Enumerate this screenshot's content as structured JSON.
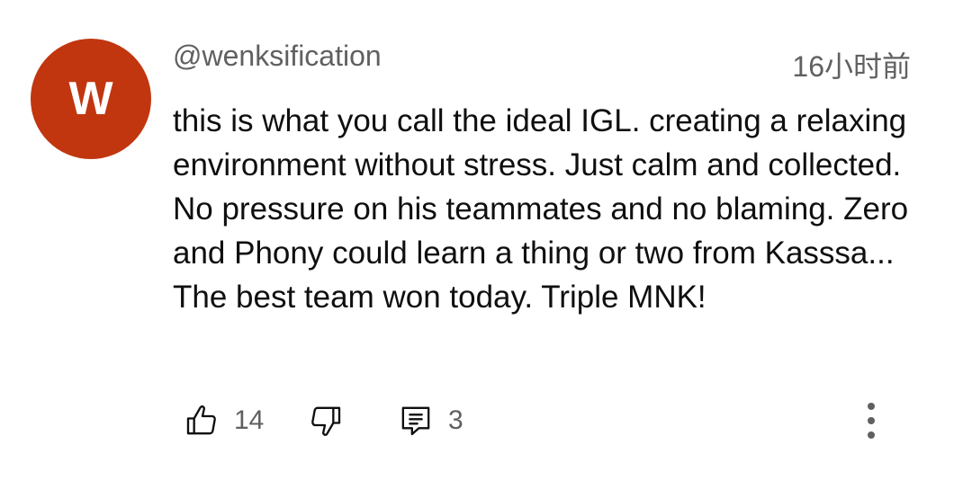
{
  "comment": {
    "avatar_letter": "W",
    "avatar_color": "#c1360f",
    "author": "@wenksification",
    "timestamp": "16小时前",
    "text": "this is what you call the ideal IGL. creating a relaxing environment without stress. Just calm and collected. No pressure on his teammates and no blaming. Zero and Phony could learn a thing or two from Kasssa... The best team won today. Triple MNK!",
    "likes": "14",
    "replies": "3"
  },
  "icons": {
    "like": "thumb-up-icon",
    "dislike": "thumb-down-icon",
    "reply": "comment-icon",
    "more": "more-vertical-icon"
  }
}
